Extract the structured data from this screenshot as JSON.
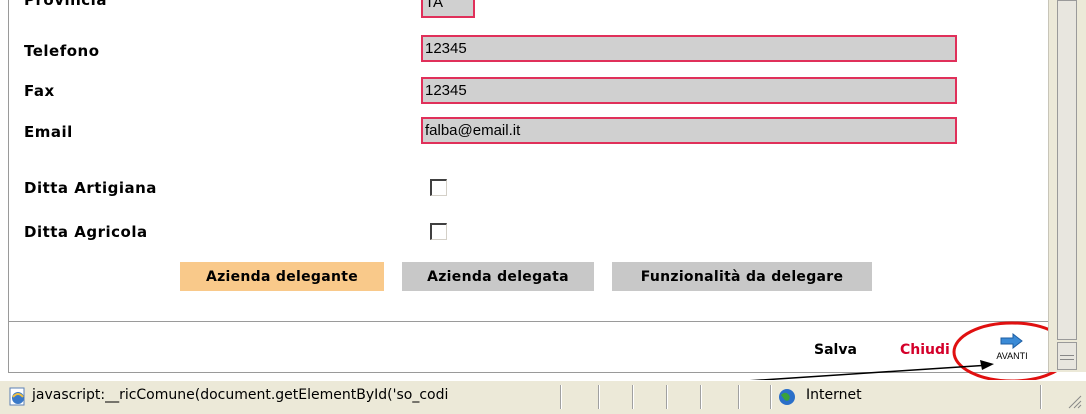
{
  "form": {
    "rows": [
      {
        "label": "Provincia",
        "value": "TA"
      },
      {
        "label": "Telefono",
        "value": "12345"
      },
      {
        "label": "Fax",
        "value": "12345"
      },
      {
        "label": "Email",
        "value": "falba@email.it"
      }
    ],
    "checkboxes": [
      {
        "label": "Ditta Artigiana",
        "checked": false
      },
      {
        "label": "Ditta Agricola",
        "checked": false
      }
    ],
    "tabs": [
      {
        "label": "Azienda delegante",
        "active": true
      },
      {
        "label": "Azienda delegata",
        "active": false
      },
      {
        "label": "Funzionalità da delegare",
        "active": false
      }
    ]
  },
  "footer": {
    "save_label": "Salva",
    "close_label": "Chiudi",
    "next_label": "AVANTI"
  },
  "statusbar": {
    "message": "javascript:__ricComune(document.getElementById('so_codi",
    "zone": "Internet"
  },
  "colors": {
    "field_border": "#e0305a",
    "active_tab": "#f9c98a",
    "inactive_tab": "#c8c8c8",
    "close_text": "#d4002a",
    "annotation_circle": "#e01010"
  }
}
